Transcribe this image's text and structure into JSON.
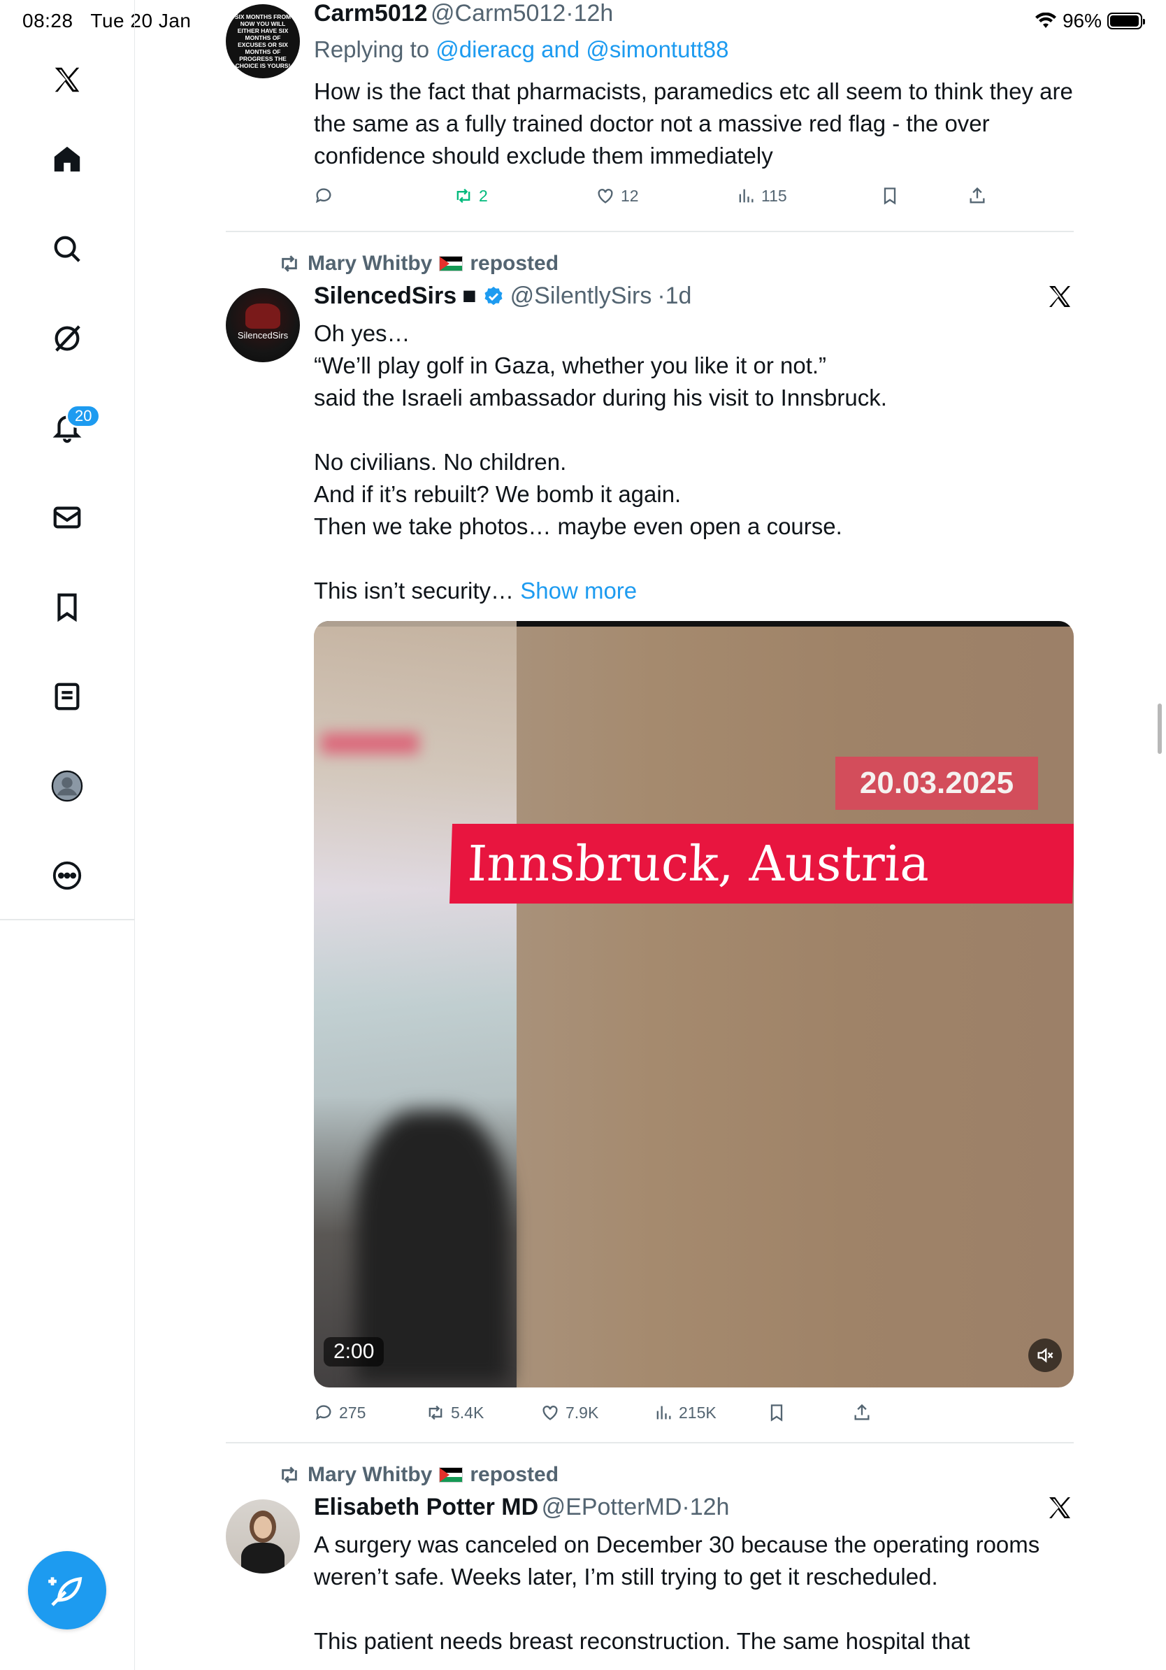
{
  "status_bar": {
    "time": "08:28",
    "date": "Tue 20 Jan",
    "battery": "96%"
  },
  "sidebar": {
    "notifications_badge": "20",
    "items": [
      {
        "name": "home"
      },
      {
        "name": "explore"
      },
      {
        "name": "grok"
      },
      {
        "name": "notifications"
      },
      {
        "name": "messages"
      },
      {
        "name": "bookmarks"
      },
      {
        "name": "lists"
      },
      {
        "name": "profile"
      },
      {
        "name": "more"
      }
    ]
  },
  "tweets": [
    {
      "avatar_text": "SIX MONTHS FROM NOW YOU WILL EITHER HAVE SIX MONTHS OF EXCUSES OR SIX MONTHS OF PROGRESS THE CHOICE IS YOURS!",
      "name": "Carm5012",
      "handle": "@Carm5012",
      "time": "·12h",
      "replying_prefix": "Replying to ",
      "replying_to": "@dieracg and @simontutt88",
      "text": "How is the fact that pharmacists, paramedics etc all seem to think they are the same as a fully trained doctor not a massive red flag - the over confidence should exclude them immediately",
      "replies": "",
      "reposts": "2",
      "likes": "12",
      "views": "115"
    },
    {
      "repost_label": "Mary Whitby",
      "repost_suffix": "reposted",
      "avatar_text": "SilencedSirs",
      "name": "SilencedSirs",
      "name_suffix": "■",
      "handle": "@SilentlySirs",
      "time": "·1d",
      "text": "Oh yes…\n“We’ll play golf in Gaza, whether you like it or not.”\nsaid the Israeli ambassador during his visit to Innsbruck.\n\nNo civilians. No children.\nAnd if it’s rebuilt? We bomb it again.\nThen we take photos… maybe even open a course.\n\nThis isn’t security… ",
      "show_more": "Show more",
      "video": {
        "date_caption": "20.03.2025",
        "location_caption": "Innsbruck, Austria",
        "duration": "2:00"
      },
      "replies": "275",
      "reposts": "5.4K",
      "likes": "7.9K",
      "views": "215K"
    },
    {
      "repost_label": "Mary Whitby",
      "repost_suffix": "reposted",
      "name": "Elisabeth Potter MD",
      "handle": "@EPotterMD",
      "time": "·12h",
      "text": "A surgery was canceled on December 30 because the operating rooms weren’t safe. Weeks later, I’m still trying to get it rescheduled.\n\nThis patient needs breast reconstruction. The same hospital that"
    }
  ],
  "colors": {
    "accent": "#1d9bf0",
    "secondary_text": "#536471",
    "repost_green": "#00ba7c"
  }
}
